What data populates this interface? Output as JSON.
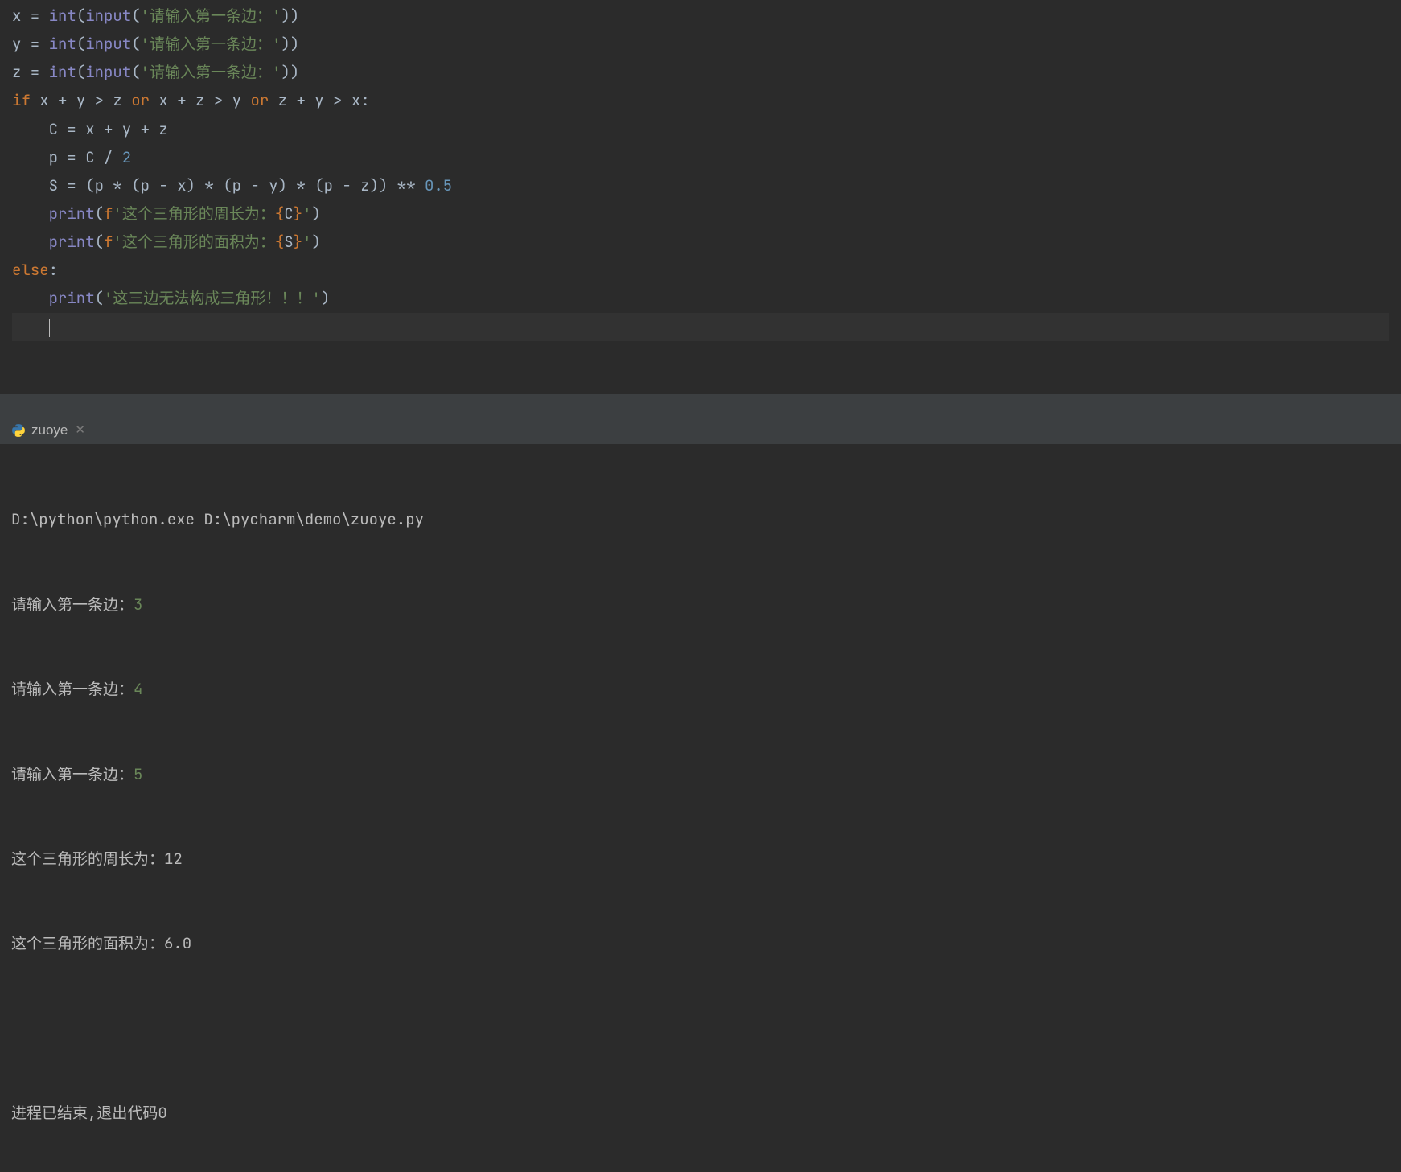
{
  "code": {
    "l1": {
      "var": "x",
      "prompt": "请输入第一条边："
    },
    "l2": {
      "var": "y",
      "prompt": "请输入第一条边："
    },
    "l3": {
      "var": "z",
      "prompt": "请输入第一条边："
    },
    "if_kw": "if",
    "cond_p1": " x + y > z ",
    "or_kw": "or",
    "cond_p2": " x + z > y ",
    "cond_p3": " z + y > x:",
    "body1": "C = x + y + z",
    "body2_lhs": "p = C / ",
    "body2_num": "2",
    "body3_lhs": "S = (p * (p - x) * (p - y) * (p - z)) ** ",
    "body3_num": "0.5",
    "print_fn": "print",
    "fprefix": "f",
    "perimeter_text": "这个三角形的周长为：",
    "perimeter_var": "C",
    "area_text": "这个三角形的面积为：",
    "area_var": "S",
    "else_kw": "else",
    "err_text": "这三边无法构成三角形！！！",
    "int_fn": "int",
    "input_fn": "input",
    "eq": " = "
  },
  "tab": {
    "name": "zuoye"
  },
  "console": {
    "path": "D:\\python\\python.exe D:\\pycharm\\demo\\zuoye.py",
    "p1": {
      "label": "请输入第一条边：",
      "val": "3"
    },
    "p2": {
      "label": "请输入第一条边：",
      "val": "4"
    },
    "p3": {
      "label": "请输入第一条边：",
      "val": "5"
    },
    "out1": "这个三角形的周长为：12",
    "out2": "这个三角形的面积为：6.0",
    "exit": "进程已结束,退出代码0"
  }
}
